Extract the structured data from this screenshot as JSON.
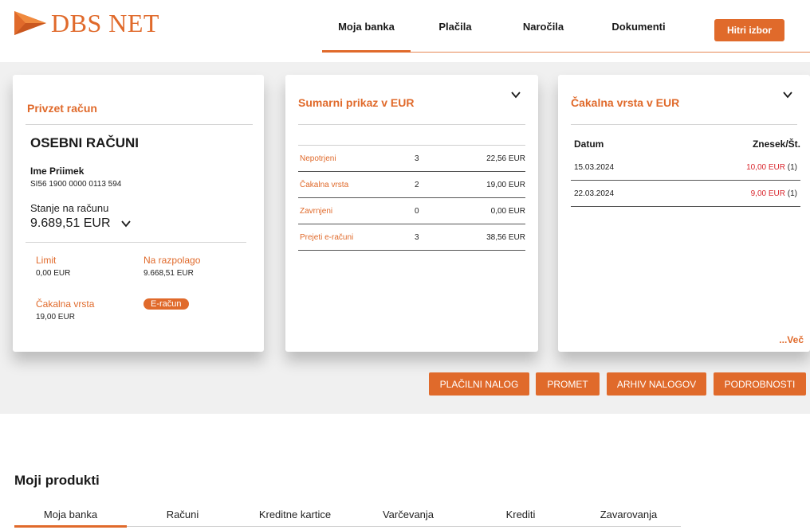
{
  "brand": {
    "name": "DBS NET",
    "accent": "#e06a2b",
    "alert": "#d9262d"
  },
  "topnav": {
    "items": [
      {
        "label": "Moja banka",
        "active": true
      },
      {
        "label": "Plačila",
        "active": false
      },
      {
        "label": "Naročila",
        "active": false
      },
      {
        "label": "Dokumenti",
        "active": false
      }
    ],
    "quick_button": "Hitri izbor"
  },
  "account_card": {
    "title": "Privzet račun",
    "heading": "OSEBNI RAČUNI",
    "holder": "Ime Priimek",
    "iban": "SI56 1900 0000 0113 594",
    "balance_label": "Stanje na računu",
    "balance_value": "9.689,51 EUR",
    "limit_label": "Limit",
    "limit_value": "0,00 EUR",
    "available_label": "Na razpolago",
    "available_value": "9.668,51 EUR",
    "queue_label": "Čakalna vrsta",
    "queue_value": "19,00 EUR",
    "ebadge": "E-račun"
  },
  "summary_card": {
    "title": "Sumarni prikaz v EUR",
    "rows": [
      {
        "label": "Nepotrjeni",
        "count": "3",
        "amount": "22,56 EUR"
      },
      {
        "label": "Čakalna vrsta",
        "count": "2",
        "amount": "19,00 EUR"
      },
      {
        "label": "Zavrnjeni",
        "count": "0",
        "amount": "0,00 EUR"
      },
      {
        "label": "Prejeti e-računi",
        "count": "3",
        "amount": "38,56 EUR"
      }
    ]
  },
  "queue_card": {
    "title": "Čakalna vrsta v EUR",
    "col_date": "Datum",
    "col_amount": "Znesek/Št.",
    "rows": [
      {
        "date": "15.03.2024",
        "amount": "10,00 EUR",
        "count": "(1)"
      },
      {
        "date": "22.03.2024",
        "amount": "9,00 EUR",
        "count": "(1)"
      }
    ],
    "more": "...Več"
  },
  "actions": {
    "payment_order": "PLAČILNI NALOG",
    "transactions": "PROMET",
    "order_archive": "ARHIV NALOGOV",
    "details": "PODROBNOSTI"
  },
  "products": {
    "title": "Moji produkti",
    "tabs": [
      {
        "label": "Moja banka",
        "active": true
      },
      {
        "label": "Računi",
        "active": false
      },
      {
        "label": "Kreditne kartice",
        "active": false
      },
      {
        "label": "Varčevanja",
        "active": false
      },
      {
        "label": "Krediti",
        "active": false
      },
      {
        "label": "Zavarovanja",
        "active": false
      }
    ]
  }
}
